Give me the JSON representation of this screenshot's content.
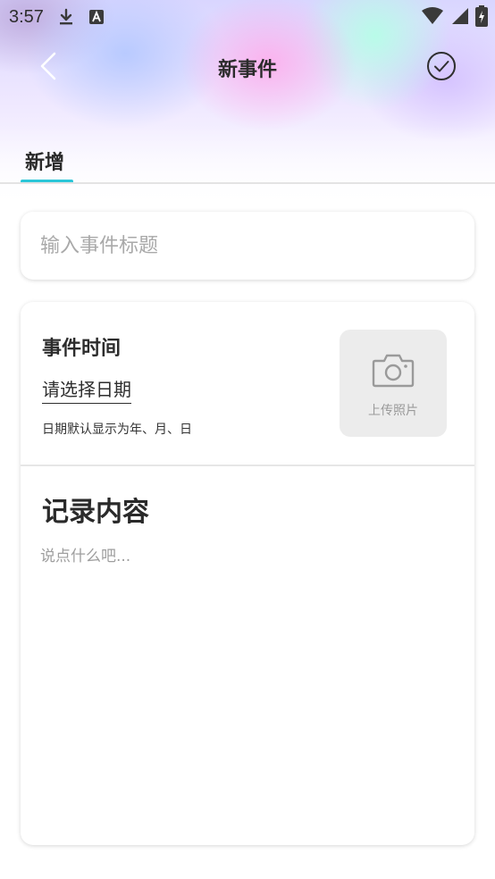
{
  "status_bar": {
    "time": "3:57",
    "icons": [
      "download-icon",
      "keyboard-a-icon",
      "wifi-icon",
      "cell-signal-icon",
      "battery-charging-icon"
    ]
  },
  "top_bar": {
    "title": "新事件",
    "back_icon": "chevron-left-icon",
    "confirm_icon": "check-circle-icon"
  },
  "tabs": [
    {
      "label": "新增",
      "active": true
    }
  ],
  "title_field": {
    "placeholder": "输入事件标题",
    "value": ""
  },
  "event_time": {
    "label": "事件时间",
    "date_placeholder": "请选择日期",
    "hint": "日期默认显示为年、月、日"
  },
  "photo_upload": {
    "label": "上传照片",
    "icon": "camera-icon"
  },
  "content": {
    "label": "记录内容",
    "placeholder": "说点什么吧...",
    "value": ""
  },
  "colors": {
    "accent": "#2bc6d8",
    "upload_bg": "#ececec"
  }
}
